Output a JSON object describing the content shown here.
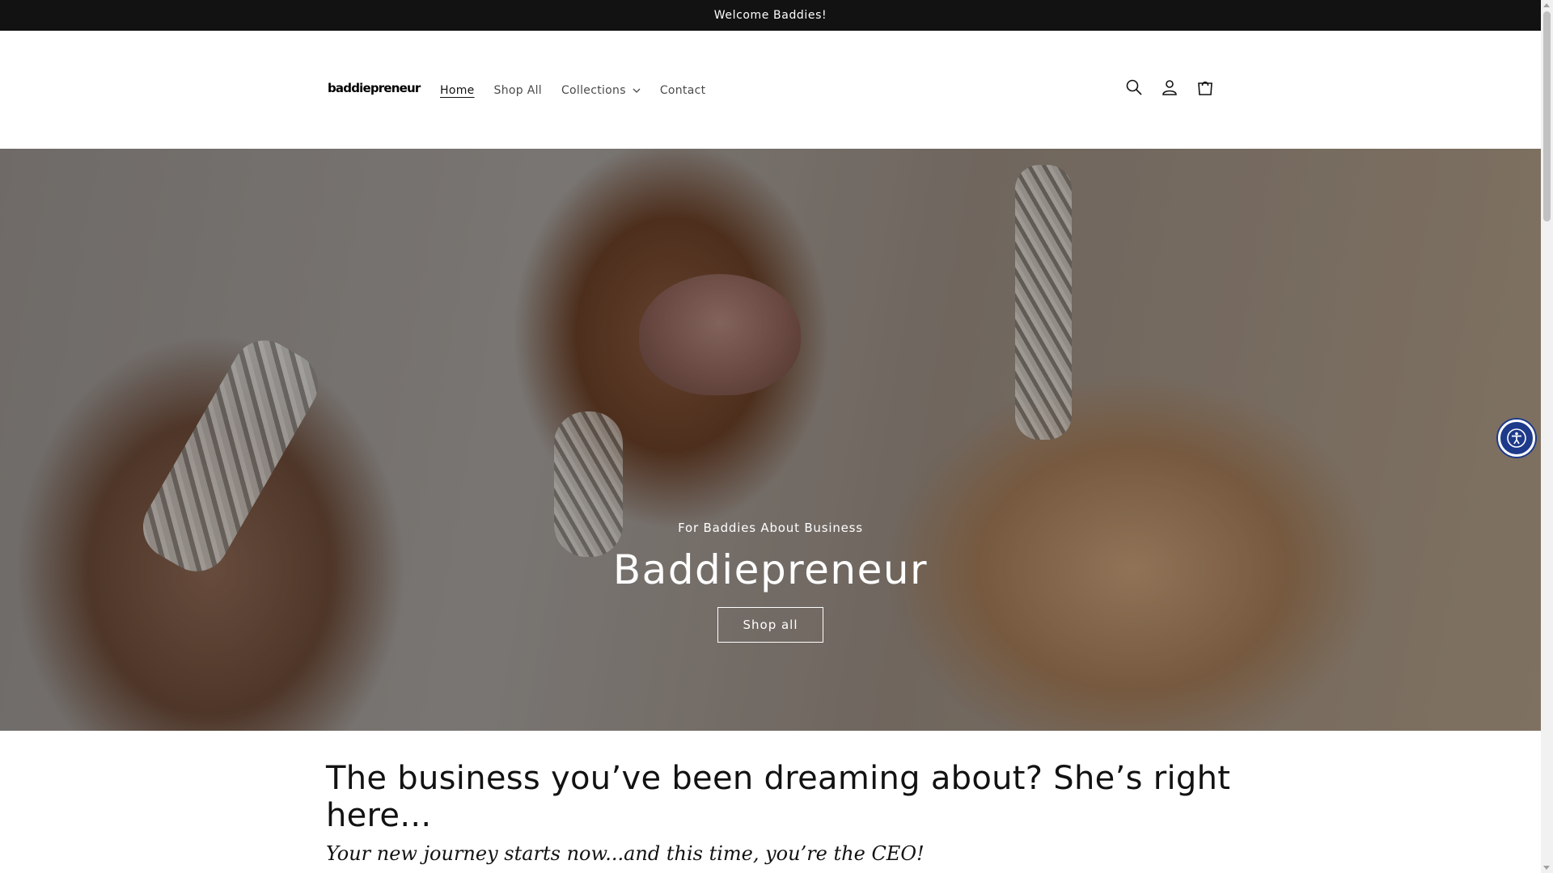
{
  "announcement": {
    "text": "Welcome Baddies!"
  },
  "header": {
    "logo_text": "baddiepreneur",
    "nav": [
      {
        "label": "Home",
        "active": true
      },
      {
        "label": "Shop All",
        "active": false
      },
      {
        "label": "Collections",
        "active": false,
        "has_dropdown": true
      },
      {
        "label": "Contact",
        "active": false
      }
    ],
    "icons": [
      "search-icon",
      "account-icon",
      "cart-icon"
    ]
  },
  "hero": {
    "subheading": "For Baddies About Business",
    "title": "Baddiepreneur",
    "button_label": "Shop all"
  },
  "intro": {
    "title": "The business you’ve been dreaming about? She’s right here...",
    "subtitle": "Your new journey starts now...and this time, you’re the CEO!"
  },
  "accessibility_widget": {
    "icon": "accessibility-icon",
    "color": "#1e3a8a"
  }
}
